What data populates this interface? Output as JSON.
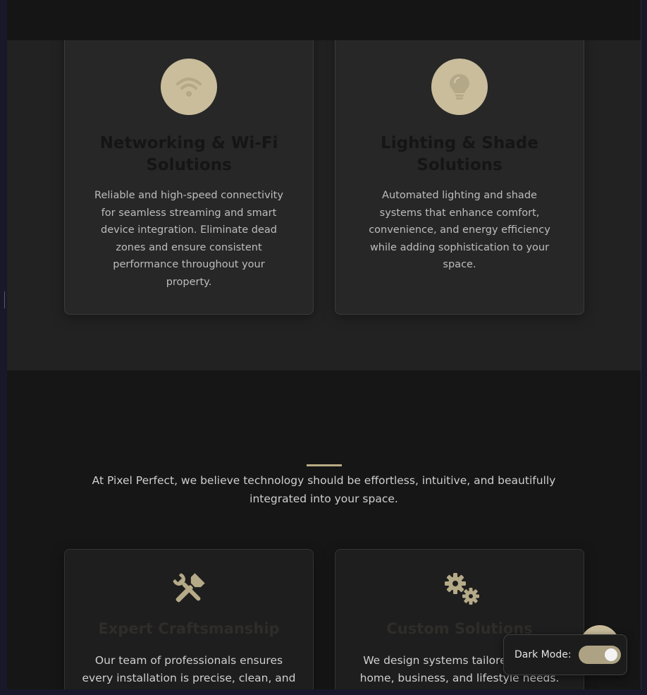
{
  "services": {
    "cards": [
      {
        "icon": "wifi-icon",
        "title": "Networking & Wi-Fi Solutions",
        "description": "Reliable and high-speed connectivity for seamless streaming and smart device integration. Eliminate dead zones and ensure consistent performance throughout your property."
      },
      {
        "icon": "lightbulb-icon",
        "title": "Lighting & Shade Solutions",
        "description": "Automated lighting and shade systems that enhance comfort, convenience, and energy efficiency while adding sophistication to your space."
      }
    ]
  },
  "about": {
    "mission": "At Pixel Perfect, we believe technology should be effortless, intuitive, and beautifully integrated into your space.",
    "features": [
      {
        "icon": "tools-icon",
        "title": "Expert Craftsmanship",
        "description": "Our team of professionals ensures every installation is precise, clean, and"
      },
      {
        "icon": "gears-icon",
        "title": "Custom Solutions",
        "description": "We design systems tailored to your home, business, and lifestyle needs."
      }
    ]
  },
  "theme_toggle": {
    "label": "Dark Mode:",
    "enabled": true
  },
  "colors": {
    "accent": "#c9bd9c",
    "toggle_track": "#ada283",
    "background": "#161616",
    "card": "#272727"
  }
}
